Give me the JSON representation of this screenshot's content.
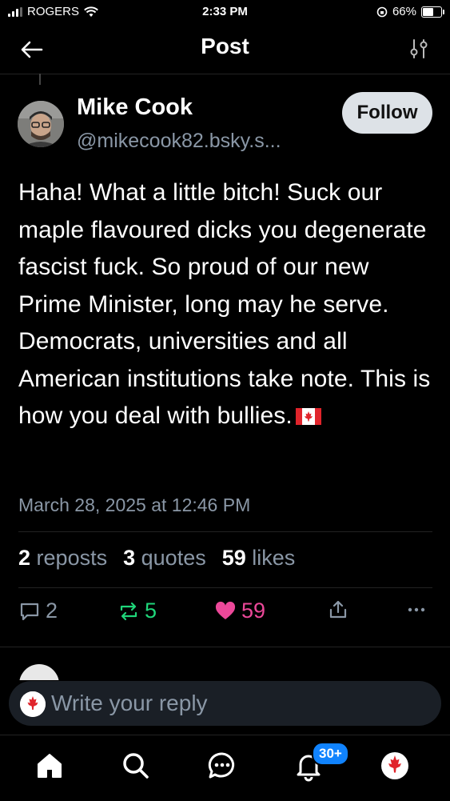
{
  "status_bar": {
    "carrier": "ROGERS",
    "time": "2:33 PM",
    "battery": "66%",
    "battery_level": 0.66
  },
  "header": {
    "title": "Post"
  },
  "post": {
    "author_name": "Mike Cook",
    "author_handle": "@mikecook82.bsky.s...",
    "follow_label": "Follow",
    "text": "Haha! What a little bitch! Suck our maple flavoured dicks you degenerate fascist fuck. So proud of our new Prime Minister, long may he serve. Democrats, universities and all American institutions take note. This is how you deal with bullies.",
    "timestamp": "March 28, 2025 at 12:46 PM",
    "stats": {
      "reposts_count": "2",
      "reposts_label": "reposts",
      "quotes_count": "3",
      "quotes_label": "quotes",
      "likes_count": "59",
      "likes_label": "likes"
    },
    "actions": {
      "replies": "2",
      "reposts": "5",
      "likes": "59"
    }
  },
  "reply": {
    "placeholder": "Write your reply"
  },
  "tabbar": {
    "notifications_badge": "30+"
  },
  "colors": {
    "background": "#000000",
    "muted_text": "#8a97a6",
    "repost_green": "#1fd67a",
    "like_pink": "#ec4899",
    "badge_blue": "#1083fe"
  }
}
